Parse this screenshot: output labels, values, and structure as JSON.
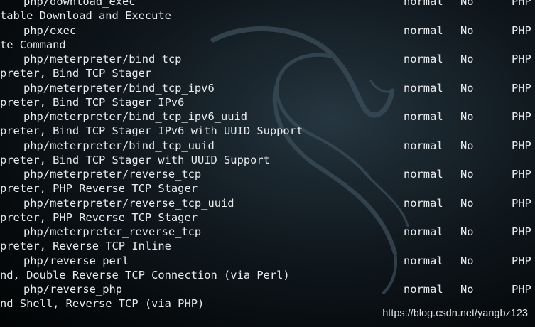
{
  "terminal": {
    "rows": [
      {
        "name": "php/download_exec",
        "rank": "normal",
        "check": "No",
        "platform": "PHP"
      },
      {
        "desc": "table Download and Execute"
      },
      {
        "name": "php/exec",
        "rank": "normal",
        "check": "No",
        "platform": "PHP"
      },
      {
        "desc": "te Command"
      },
      {
        "name": "php/meterpreter/bind_tcp",
        "rank": "normal",
        "check": "No",
        "platform": "PHP"
      },
      {
        "desc": "preter, Bind TCP Stager"
      },
      {
        "name": "php/meterpreter/bind_tcp_ipv6",
        "rank": "normal",
        "check": "No",
        "platform": "PHP"
      },
      {
        "desc": "preter, Bind TCP Stager IPv6"
      },
      {
        "name": "php/meterpreter/bind_tcp_ipv6_uuid",
        "rank": "normal",
        "check": "No",
        "platform": "PHP"
      },
      {
        "desc": "preter, Bind TCP Stager IPv6 with UUID Support"
      },
      {
        "name": "php/meterpreter/bind_tcp_uuid",
        "rank": "normal",
        "check": "No",
        "platform": "PHP"
      },
      {
        "desc": "preter, Bind TCP Stager with UUID Support"
      },
      {
        "name": "php/meterpreter/reverse_tcp",
        "rank": "normal",
        "check": "No",
        "platform": "PHP"
      },
      {
        "desc": "preter, PHP Reverse TCP Stager"
      },
      {
        "name": "php/meterpreter/reverse_tcp_uuid",
        "rank": "normal",
        "check": "No",
        "platform": "PHP"
      },
      {
        "desc": "preter, PHP Reverse TCP Stager"
      },
      {
        "name": "php/meterpreter_reverse_tcp",
        "rank": "normal",
        "check": "No",
        "platform": "PHP"
      },
      {
        "desc": "preter, Reverse TCP Inline"
      },
      {
        "name": "php/reverse_perl",
        "rank": "normal",
        "check": "No",
        "platform": "PHP"
      },
      {
        "desc": "nd, Double Reverse TCP Connection (via Perl)"
      },
      {
        "name": "php/reverse_php",
        "rank": "normal",
        "check": "No",
        "platform": "PHP"
      },
      {
        "desc": "nd Shell, Reverse TCP (via PHP)"
      }
    ]
  },
  "watermark": "https://blog.csdn.net/yangbz123",
  "colors": {
    "background": "#0f171c",
    "text": "#e9ecef",
    "dragon": "#3a4c57"
  },
  "icons": {
    "background_logo": "kali-dragon-icon"
  }
}
